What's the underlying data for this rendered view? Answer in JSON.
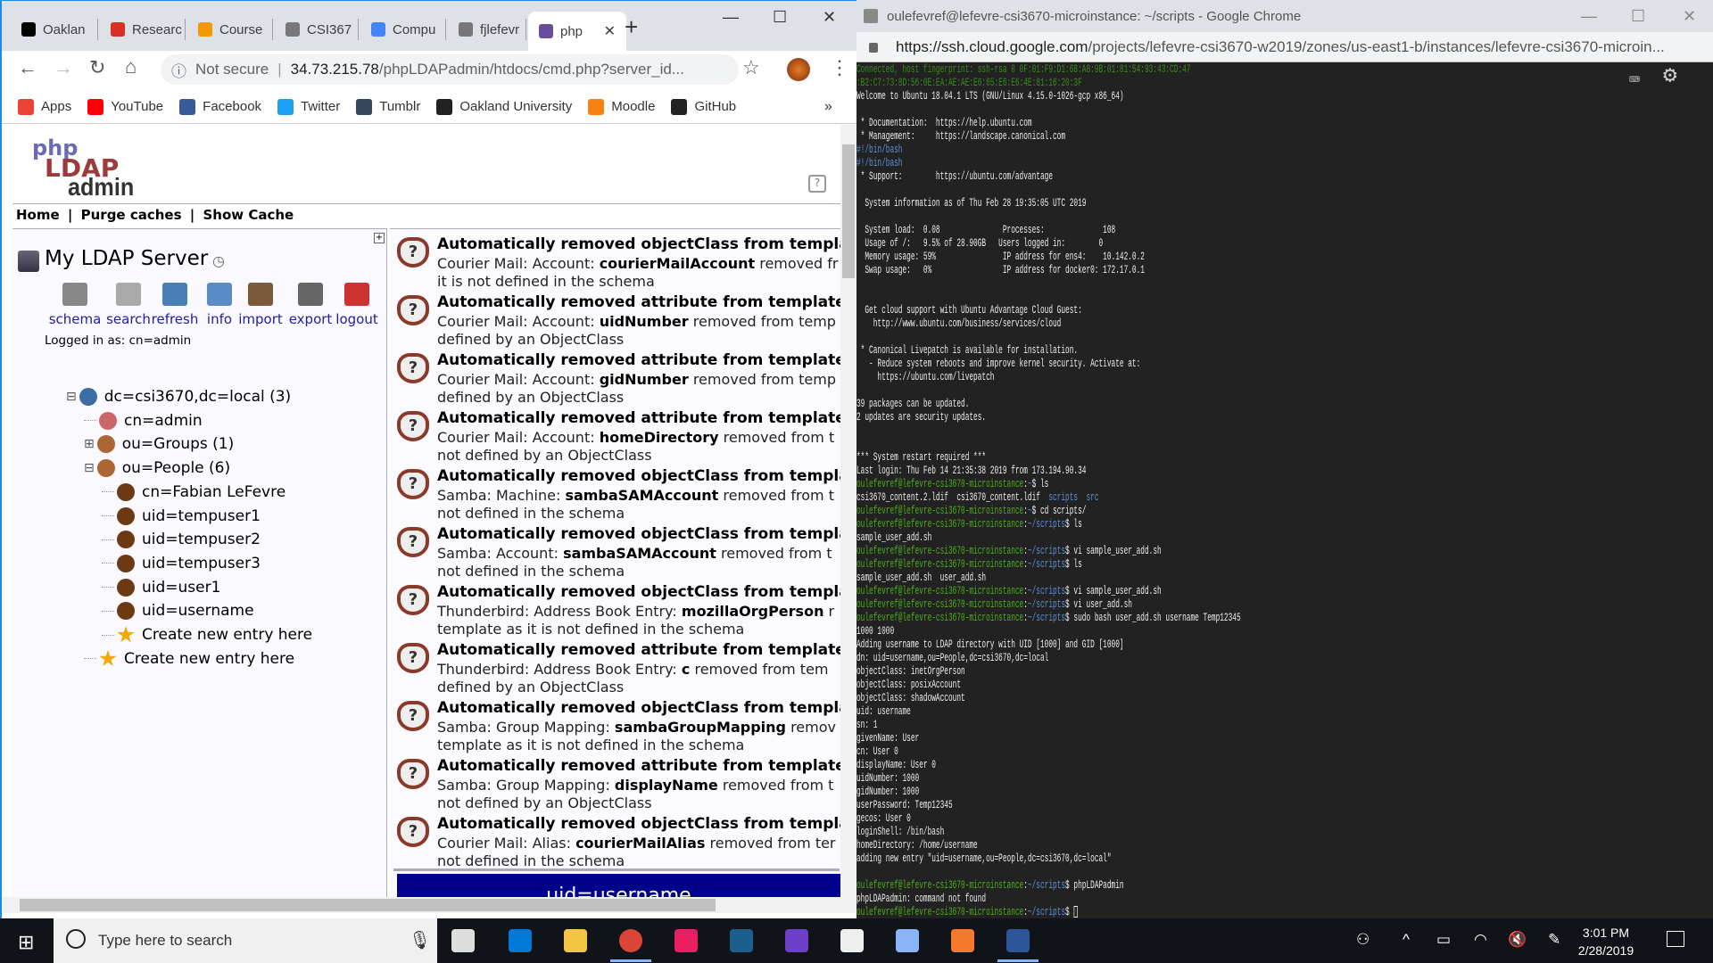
{
  "browser": {
    "tabs": [
      {
        "label": "Oaklan",
        "color": "#000"
      },
      {
        "label": "Researc",
        "color": "#d93025"
      },
      {
        "label": "Course",
        "color": "#f29900"
      },
      {
        "label": "CSI367",
        "color": "#777"
      },
      {
        "label": "Compu",
        "color": "#4285f4"
      },
      {
        "label": "fjlefevr",
        "color": "#777"
      },
      {
        "label": "php",
        "color": "#6a4c9c"
      }
    ],
    "new_tab": "+",
    "url_security": "Not secure",
    "url_host": "34.73.215.78",
    "url_path": "/phpLDAPadmin/htdocs/cmd.php?server_id...",
    "bookmarks": [
      {
        "label": "Apps",
        "color": "#ea4335"
      },
      {
        "label": "YouTube",
        "color": "#ff0000"
      },
      {
        "label": "Facebook",
        "color": "#3b5998"
      },
      {
        "label": "Twitter",
        "color": "#1da1f2"
      },
      {
        "label": "Tumblr",
        "color": "#36465d"
      },
      {
        "label": "Oakland University",
        "color": "#222"
      },
      {
        "label": "Moodle",
        "color": "#f98012"
      },
      {
        "label": "GitHub",
        "color": "#222"
      }
    ],
    "bookmarks_more": "»"
  },
  "ldap": {
    "logo": "phpLDAPadmin",
    "nav": [
      "Home",
      "|",
      "Purge caches",
      "|",
      "Show Cache"
    ],
    "server": "My LDAP Server",
    "actions": [
      {
        "label": "schema",
        "color": "#888"
      },
      {
        "label": "search",
        "color": "#aaa"
      },
      {
        "label": "refresh",
        "color": "#4a7fb5"
      },
      {
        "label": "info",
        "color": "#5a8cc8"
      },
      {
        "label": "import",
        "color": "#7a5a3a"
      },
      {
        "label": "export",
        "color": "#666"
      },
      {
        "label": "logout",
        "color": "#c33"
      }
    ],
    "logged_in": "Logged in as: cn=admin",
    "tree": [
      {
        "label": "dc=csi3670,dc=local (3)",
        "toggle": "⊟",
        "icon": "globe",
        "color": "#3a6ea5"
      },
      {
        "label": "cn=admin",
        "icon": "admin",
        "color": "#c66"
      },
      {
        "label": "ou=Groups (1)",
        "toggle": "⊞",
        "icon": "group",
        "color": "#a63"
      },
      {
        "label": "ou=People (6)",
        "toggle": "⊟",
        "icon": "group",
        "color": "#a63"
      },
      {
        "label": "cn=Fabian LeFevre",
        "icon": "user",
        "color": "#6b3a12"
      },
      {
        "label": "uid=tempuser1",
        "icon": "user",
        "color": "#6b3a12"
      },
      {
        "label": "uid=tempuser2",
        "icon": "user",
        "color": "#6b3a12"
      },
      {
        "label": "uid=tempuser3",
        "icon": "user",
        "color": "#6b3a12"
      },
      {
        "label": "uid=user1",
        "icon": "user",
        "color": "#6b3a12"
      },
      {
        "label": "uid=username",
        "icon": "user",
        "color": "#6b3a12"
      },
      {
        "label": "Create new entry here",
        "icon": "star",
        "color": "#f5a800"
      },
      {
        "label": "Create new entry here",
        "icon": "star",
        "color": "#f5a800"
      }
    ],
    "messages": [
      {
        "title": "Automatically removed objectClass from template",
        "pre": "Courier Mail: Account: ",
        "bold": "courierMailAccount",
        "post": " removed fr",
        "line2": "it is not defined in the schema"
      },
      {
        "title": "Automatically removed attribute from template",
        "pre": "Courier Mail: Account: ",
        "bold": "uidNumber",
        "post": " removed from temp",
        "line2": "defined by an ObjectClass"
      },
      {
        "title": "Automatically removed attribute from template",
        "pre": "Courier Mail: Account: ",
        "bold": "gidNumber",
        "post": " removed from temp",
        "line2": "defined by an ObjectClass"
      },
      {
        "title": "Automatically removed attribute from template",
        "pre": "Courier Mail: Account: ",
        "bold": "homeDirectory",
        "post": " removed from t",
        "line2": "not defined by an ObjectClass"
      },
      {
        "title": "Automatically removed objectClass from template",
        "pre": "Samba: Machine: ",
        "bold": "sambaSAMAccount",
        "post": " removed from t",
        "line2": "not defined in the schema"
      },
      {
        "title": "Automatically removed objectClass from template",
        "pre": "Samba: Account: ",
        "bold": "sambaSAMAccount",
        "post": " removed from t",
        "line2": "not defined in the schema"
      },
      {
        "title": "Automatically removed objectClass from template",
        "pre": "Thunderbird: Address Book Entry: ",
        "bold": "mozillaOrgPerson",
        "post": " r",
        "line2": "template as it is not defined in the schema"
      },
      {
        "title": "Automatically removed attribute from template",
        "pre": "Thunderbird: Address Book Entry: ",
        "bold": "c",
        "post": " removed from tem",
        "line2": "defined by an ObjectClass"
      },
      {
        "title": "Automatically removed objectClass from template",
        "pre": "Samba: Group Mapping: ",
        "bold": "sambaGroupMapping",
        "post": " remov",
        "line2": "template as it is not defined in the schema"
      },
      {
        "title": "Automatically removed attribute from template",
        "pre": "Samba: Group Mapping: ",
        "bold": "displayName",
        "post": " removed from t",
        "line2": "not defined by an ObjectClass"
      },
      {
        "title": "Automatically removed objectClass from template",
        "pre": "Courier Mail: Alias: ",
        "bold": "courierMailAlias",
        "post": " removed from ter",
        "line2": "not defined in the schema"
      }
    ],
    "entry_header": "uid=username"
  },
  "ssh": {
    "title": "oulefevref@lefevre-csi3670-microinstance: ~/scripts - Google Chrome",
    "url_host": "https://ssh.cloud.google.com",
    "url_path": "/projects/lefevre-csi3670-w2019/zones/us-east1-b/instances/lefevre-csi3670-microin..."
  },
  "terminal": {
    "lines": [
      [
        [
          "dg",
          "Connected, host fingerprint: ssh-rsa 0 0F:01:F9:D1:68:A8:9B:01:81:54:93:43:CD:47"
        ]
      ],
      [
        [
          "dg",
          ":B2:C7:73:8D:56:0E:EA:AE:AE:E6:65:E6:E6:4E:81:16:20:3F"
        ]
      ],
      [
        [
          "w",
          "Welcome to Ubuntu 18.04.1 LTS (GNU/Linux 4.15.0-1026-gcp x86_64)"
        ]
      ],
      [],
      [
        [
          "w",
          " * Documentation:  https://help.ubuntu.com"
        ]
      ],
      [
        [
          "w",
          " * Management:     https://landscape.canonical.com"
        ]
      ],
      [
        [
          "b",
          "#!/bin/bash"
        ]
      ],
      [
        [
          "b",
          "#!/bin/bash"
        ]
      ],
      [
        [
          "w",
          " * Support:        https://ubuntu.com/advantage"
        ]
      ],
      [],
      [
        [
          "w",
          "  System information as of Thu Feb 28 19:35:05 UTC 2019"
        ]
      ],
      [],
      [
        [
          "w",
          "  System load:  0.08               Processes:              108"
        ]
      ],
      [
        [
          "w",
          "  Usage of /:   9.5% of 28.90GB   Users logged in:        0"
        ]
      ],
      [
        [
          "w",
          "  Memory usage: 59%                IP address for ens4:    10.142.0.2"
        ]
      ],
      [
        [
          "w",
          "  Swap usage:   0%                 IP address for docker0: 172.17.0.1"
        ]
      ],
      [],
      [],
      [
        [
          "w",
          "  Get cloud support with Ubuntu Advantage Cloud Guest:"
        ]
      ],
      [
        [
          "w",
          "    http://www.ubuntu.com/business/services/cloud"
        ]
      ],
      [],
      [
        [
          "w",
          " * Canonical Livepatch is available for installation."
        ]
      ],
      [
        [
          "w",
          "   - Reduce system reboots and improve kernel security. Activate at:"
        ]
      ],
      [
        [
          "w",
          "     https://ubuntu.com/livepatch"
        ]
      ],
      [],
      [
        [
          "w",
          "39 packages can be updated."
        ]
      ],
      [
        [
          "w",
          "2 updates are security updates."
        ]
      ],
      [],
      [],
      [
        [
          "w",
          "*** System restart required ***"
        ]
      ],
      [
        [
          "w",
          "Last login: Thu Feb 14 21:35:38 2019 from 173.194.90.34"
        ]
      ],
      [
        [
          "g",
          "oulefevref@lefevre-csi3670-microinstance"
        ],
        [
          "w",
          ":"
        ],
        [
          "b",
          "~"
        ],
        [
          "w",
          "$ ls"
        ]
      ],
      [
        [
          "w",
          "csi3670_content.2.ldif  csi3670_content.ldif  "
        ],
        [
          "b",
          "scripts"
        ],
        [
          "w",
          "  "
        ],
        [
          "b",
          "src"
        ]
      ],
      [
        [
          "g",
          "oulefevref@lefevre-csi3670-microinstance"
        ],
        [
          "w",
          ":"
        ],
        [
          "b",
          "~"
        ],
        [
          "w",
          "$ cd scripts/"
        ]
      ],
      [
        [
          "g",
          "oulefevref@lefevre-csi3670-microinstance"
        ],
        [
          "w",
          ":"
        ],
        [
          "b",
          "~/scripts"
        ],
        [
          "w",
          "$ ls"
        ]
      ],
      [
        [
          "w",
          "sample_user_add.sh"
        ]
      ],
      [
        [
          "g",
          "oulefevref@lefevre-csi3670-microinstance"
        ],
        [
          "w",
          ":"
        ],
        [
          "b",
          "~/scripts"
        ],
        [
          "w",
          "$ vi sample_user_add.sh"
        ]
      ],
      [
        [
          "g",
          "oulefevref@lefevre-csi3670-microinstance"
        ],
        [
          "w",
          ":"
        ],
        [
          "b",
          "~/scripts"
        ],
        [
          "w",
          "$ ls"
        ]
      ],
      [
        [
          "w",
          "sample_user_add.sh  user_add.sh"
        ]
      ],
      [
        [
          "g",
          "oulefevref@lefevre-csi3670-microinstance"
        ],
        [
          "w",
          ":"
        ],
        [
          "b",
          "~/scripts"
        ],
        [
          "w",
          "$ vi sample_user_add.sh"
        ]
      ],
      [
        [
          "g",
          "oulefevref@lefevre-csi3670-microinstance"
        ],
        [
          "w",
          ":"
        ],
        [
          "b",
          "~/scripts"
        ],
        [
          "w",
          "$ vi user_add.sh"
        ]
      ],
      [
        [
          "g",
          "oulefevref@lefevre-csi3670-microinstance"
        ],
        [
          "w",
          ":"
        ],
        [
          "b",
          "~/scripts"
        ],
        [
          "w",
          "$ sudo bash user_add.sh username Temp12345"
        ]
      ],
      [
        [
          "w",
          "1000 1000"
        ]
      ],
      [
        [
          "w",
          "Adding username to LDAP directory with UID [1000] and GID [1000]"
        ]
      ],
      [
        [
          "w",
          "dn: uid=username,ou=People,dc=csi3670,dc=local"
        ]
      ],
      [
        [
          "w",
          "objectClass: inetOrgPerson"
        ]
      ],
      [
        [
          "w",
          "objectClass: posixAccount"
        ]
      ],
      [
        [
          "w",
          "objectClass: shadowAccount"
        ]
      ],
      [
        [
          "w",
          "uid: username"
        ]
      ],
      [
        [
          "w",
          "sn: 1"
        ]
      ],
      [
        [
          "w",
          "givenName: User"
        ]
      ],
      [
        [
          "w",
          "cn: User 0"
        ]
      ],
      [
        [
          "w",
          "displayName: User 0"
        ]
      ],
      [
        [
          "w",
          "uidNumber: 1000"
        ]
      ],
      [
        [
          "w",
          "gidNumber: 1000"
        ]
      ],
      [
        [
          "w",
          "userPassword: Temp12345"
        ]
      ],
      [
        [
          "w",
          "gecos: User 0"
        ]
      ],
      [
        [
          "w",
          "loginShell: /bin/bash"
        ]
      ],
      [
        [
          "w",
          "homeDirectory: /home/username"
        ]
      ],
      [
        [
          "w",
          "adding new entry \"uid=username,ou=People,dc=csi3670,dc=local\""
        ]
      ],
      [],
      [
        [
          "g",
          "oulefevref@lefevre-csi3670-microinstance"
        ],
        [
          "w",
          ":"
        ],
        [
          "b",
          "~/scripts"
        ],
        [
          "w",
          "$ phpLDAPadmin"
        ]
      ],
      [
        [
          "w",
          "phpLDAPadmin: command not found"
        ]
      ],
      [
        [
          "g",
          "oulefevref@lefevre-csi3670-microinstance"
        ],
        [
          "w",
          ":"
        ],
        [
          "b",
          "~/scripts"
        ],
        [
          "w",
          "$ "
        ]
      ]
    ]
  },
  "taskbar": {
    "search_placeholder": "Type here to search",
    "apps": [
      {
        "name": "task-view",
        "color": "#ddd"
      },
      {
        "name": "store",
        "color": "#0078d7"
      },
      {
        "name": "file-explorer",
        "color": "#f4c542"
      },
      {
        "name": "chrome",
        "color": "#db4437"
      },
      {
        "name": "chrome-app",
        "color": "#e91e63"
      },
      {
        "name": "steam",
        "color": "#1b5f8c"
      },
      {
        "name": "github",
        "color": "#6e40c9"
      },
      {
        "name": "unity",
        "color": "#eee"
      },
      {
        "name": "3d-viewer",
        "color": "#8ab4f8"
      },
      {
        "name": "blender",
        "color": "#f5792a"
      },
      {
        "name": "word",
        "color": "#2b579a"
      }
    ],
    "time": "3:01 PM",
    "date": "2/28/2019"
  }
}
